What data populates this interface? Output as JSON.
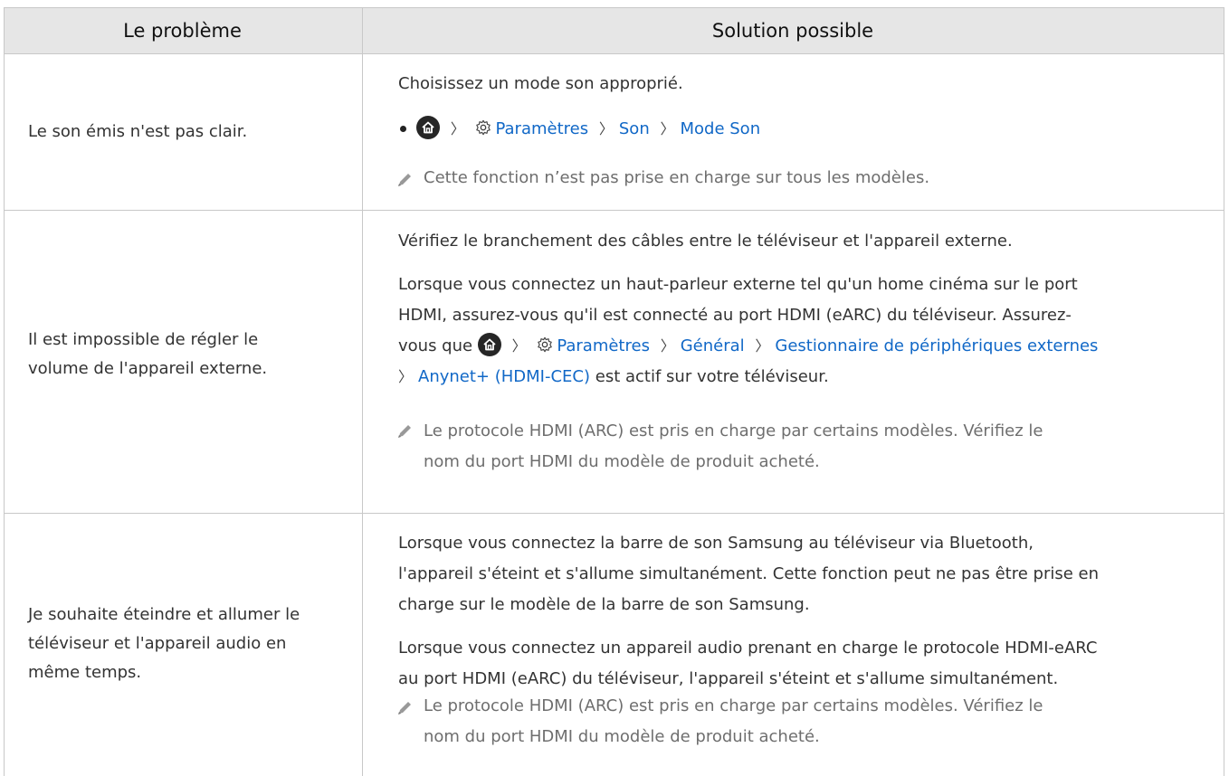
{
  "header": {
    "col1": "Le problème",
    "col2": "Solution possible"
  },
  "rows": [
    {
      "problem": "Le son émis n'est pas clair.",
      "p1": "Choisissez un mode son approprié.",
      "path": {
        "settings": "Paramètres",
        "son": "Son",
        "mode": "Mode Son"
      },
      "note": "Cette fonction n’est pas prise en charge sur tous les modèles."
    },
    {
      "problem_l1": "Il est impossible de régler le",
      "problem_l2": "volume de l'appareil externe.",
      "p1": "Vérifiez le branchement des câbles entre le téléviseur et l'appareil externe.",
      "p2_l1": "Lorsque vous connectez un haut-parleur externe tel qu'un home cinéma sur le port",
      "p2_l2": "HDMI, assurez-vous qu'il est connecté au port HDMI (eARC) du téléviseur. Assurez-",
      "p2_l3_prefix": "vous que",
      "path": {
        "settings": "Paramètres",
        "general": "Général",
        "manager": "Gestionnaire de périphériques externes",
        "anynet": "Anynet+ (HDMI-CEC)"
      },
      "p2_l4_suffix": "est actif sur votre téléviseur.",
      "note_l1": "Le protocole HDMI (ARC) est pris en charge par certains modèles. Vérifiez le",
      "note_l2": "nom du port HDMI du modèle de produit acheté."
    },
    {
      "problem_l1": "Je souhaite éteindre et allumer le",
      "problem_l2": "téléviseur et l'appareil audio en",
      "problem_l3": "même temps.",
      "p1_l1": "Lorsque vous connectez la barre de son Samsung au téléviseur via Bluetooth,",
      "p1_l2": "l'appareil s'éteint et s'allume simultanément. Cette fonction peut ne pas être prise en",
      "p1_l3": "charge sur le modèle de la barre de son Samsung.",
      "p2_l1": "Lorsque vous connectez un appareil audio prenant en charge le protocole HDMI-eARC",
      "p2_l2": "au port HDMI (eARC) du téléviseur, l'appareil s'éteint et s'allume simultanément.",
      "note_l1": "Le protocole HDMI (ARC) est pris en charge par certains modèles. Vérifiez le",
      "note_l2": "nom du port HDMI du modèle de produit acheté."
    }
  ],
  "colors": {
    "link": "#1168c7",
    "header_bg": "#e6e6e6",
    "note": "#6e6e6e"
  },
  "icons": {
    "home": "home-icon",
    "settings": "gear-icon",
    "separator": "chevron-right-icon",
    "note": "pencil-icon"
  }
}
